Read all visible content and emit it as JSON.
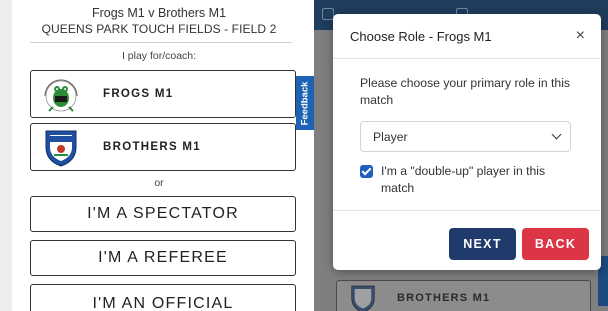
{
  "match": {
    "title": "Frogs M1 v Brothers M1",
    "venue": "QUEENS PARK TOUCH FIELDS - FIELD 2"
  },
  "play_for_label": "I play for/coach:",
  "teams": [
    {
      "name": "FROGS M1",
      "logo": "frogs-touch-club-logo"
    },
    {
      "name": "BROTHERS M1",
      "logo": "brothers-shield-logo"
    }
  ],
  "or_label": "or",
  "roles": {
    "spectator": "I'M A SPECTATOR",
    "referee": "I'M A REFEREE",
    "official": "I'M AN OFFICIAL"
  },
  "feedback_label": "Feedback",
  "modal": {
    "title": "Choose Role - Frogs M1",
    "close_glyph": "×",
    "prompt": "Please choose your primary role in this match",
    "selected_role": "Player",
    "double_up_label": "I'm a \"double-up\" player in this match",
    "double_up_checked": true,
    "next_label": "NEXT",
    "back_label": "BACK"
  },
  "background_card": {
    "name": "BROTHERS M1"
  },
  "colors": {
    "primary": "#1f3a6b",
    "danger": "#dc3545",
    "checkbox": "#1f5fbd",
    "feedback": "#1e63b3",
    "topbar": "#1f3d5c"
  }
}
